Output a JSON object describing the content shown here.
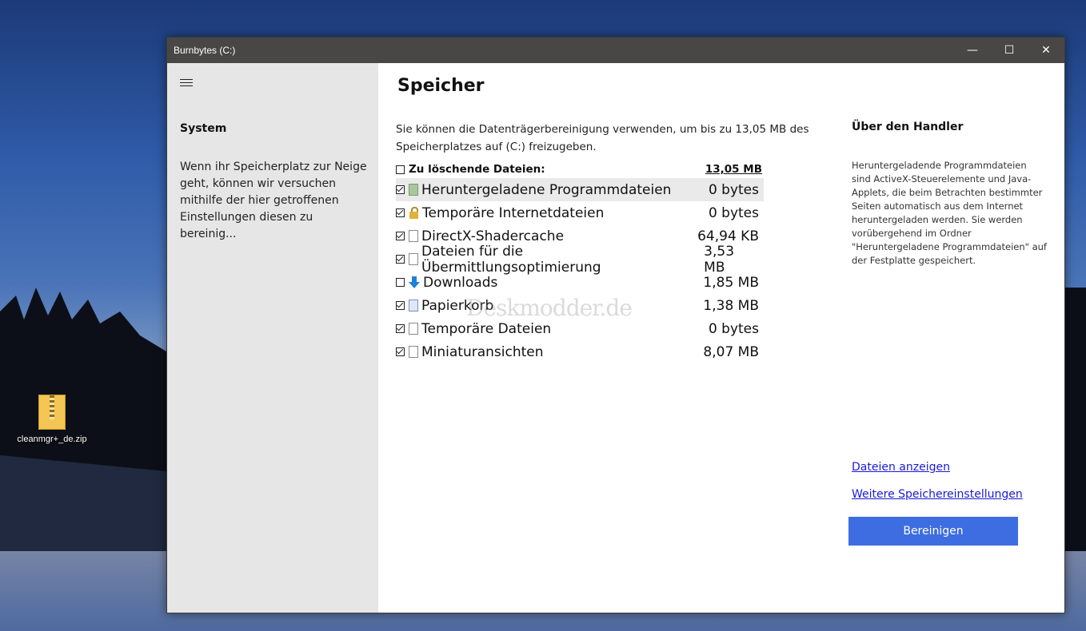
{
  "desktop": {
    "icon_label": "cleanmgr+_de.zip"
  },
  "window": {
    "title": "Burnbytes  (C:)",
    "controls": {
      "minimize": "—",
      "maximize": "☐",
      "close": "✕"
    }
  },
  "sidebar": {
    "title": "System",
    "description": "Wenn ihr Speicherplatz zur Neige geht, können wir versuchen mithilfe der hier getroffenen Einstellungen diesen zu bereinig..."
  },
  "main": {
    "heading": "Speicher",
    "intro": "Sie können die Datenträgerbereinigung verwenden, um bis zu 13,05 MB des Speicherplatzes auf  (C:) freizugeben.",
    "header_label": "Zu löschende Dateien:",
    "header_total": "13,05 MB",
    "items": [
      {
        "label": "Heruntergeladene Programmdateien",
        "size": "0 bytes",
        "checked": true,
        "icon": "program-files-icon"
      },
      {
        "label": "Temporäre Internetdateien",
        "size": "0 bytes",
        "checked": true,
        "icon": "lock-icon"
      },
      {
        "label": "DirectX-Shadercache",
        "size": "64,94 KB",
        "checked": true,
        "icon": "file-icon"
      },
      {
        "label": "Dateien für die Übermittlungsoptimierung",
        "size": "3,53 MB",
        "checked": true,
        "icon": "file-icon"
      },
      {
        "label": "Downloads",
        "size": "1,85 MB",
        "checked": false,
        "icon": "download-arrow-icon"
      },
      {
        "label": "Papierkorb",
        "size": "1,38 MB",
        "checked": true,
        "icon": "recycle-bin-icon"
      },
      {
        "label": "Temporäre Dateien",
        "size": "0 bytes",
        "checked": true,
        "icon": "file-icon"
      },
      {
        "label": "Miniaturansichten",
        "size": "8,07 MB",
        "checked": true,
        "icon": "file-icon"
      }
    ],
    "watermark": "Deskmodder.de"
  },
  "about": {
    "title": "Über den Handler",
    "text": "Heruntergeladende Programmdateien sind ActiveX-Steuerelemente und Java-Applets, die beim Betrachten bestimmter Seiten automatisch aus dem Internet heruntergeladen werden. Sie werden vorübergehend im Ordner \"Heruntergeladene Programmdateien\" auf der Festplatte gespeichert.",
    "link_show_files": "Dateien anzeigen",
    "link_more_settings": "Weitere Speichereinstellungen",
    "button_clean": "Bereinigen"
  }
}
